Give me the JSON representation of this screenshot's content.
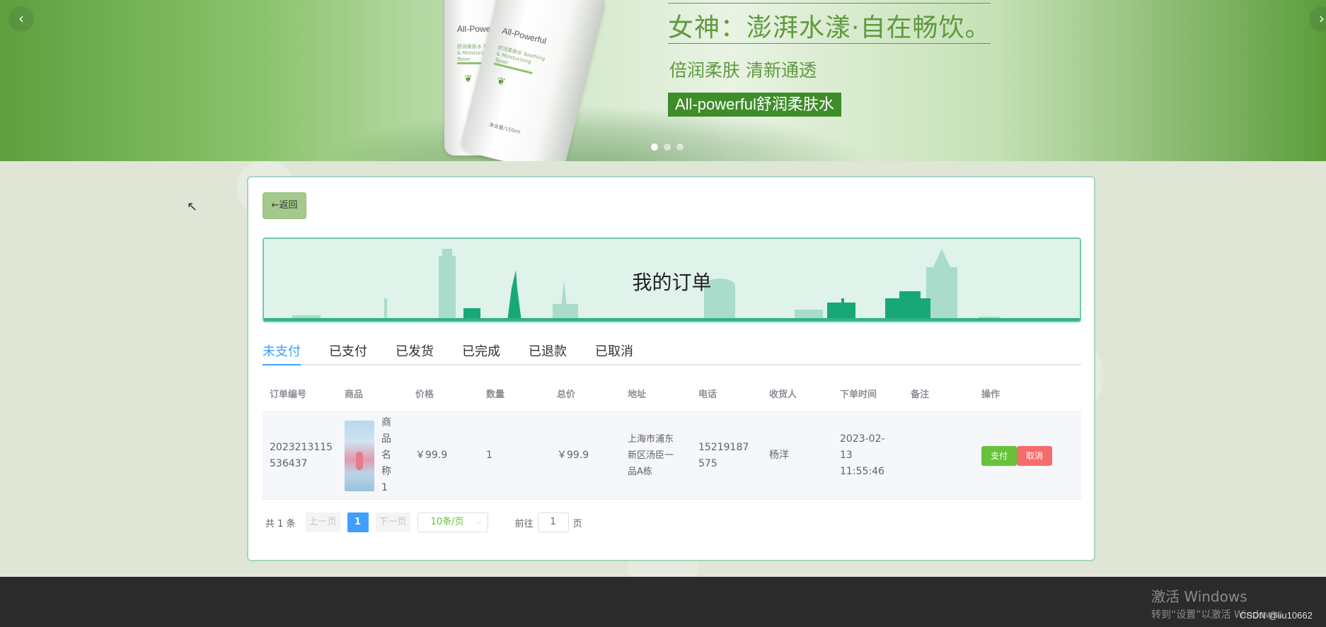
{
  "banner": {
    "headline": "女神：澎湃水漾·自在畅饮。",
    "subheadline": "倍润柔肤 清新通透",
    "tag": "All-powerful舒润柔肤水",
    "bottle_brand": "All-Powerful",
    "bottle_sub": "舒润柔肤水 Soothing & Moisturizing Toner",
    "bottle_volume": "净含量/150ml",
    "prev_arrow": "‹",
    "next_arrow": "›"
  },
  "back_button": "←返回",
  "page_title": "我的订单",
  "tabs": [
    {
      "label": "未支付"
    },
    {
      "label": "已支付"
    },
    {
      "label": "已发货"
    },
    {
      "label": "已完成"
    },
    {
      "label": "已退款"
    },
    {
      "label": "已取消"
    }
  ],
  "table": {
    "headers": [
      "订单编号",
      "商品",
      "价格",
      "数量",
      "总价",
      "地址",
      "电话",
      "收货人",
      "下单时间",
      "备注",
      "操作"
    ],
    "rows": [
      {
        "order_no": "2023213115536437",
        "product_name": "商品名称1",
        "price": "￥99.9",
        "quantity": "1",
        "total": "￥99.9",
        "address": "上海市浦东新区汤臣一品A栋",
        "phone": "15219187575",
        "receiver": "杨洋",
        "order_time": "2023-02-13 11:55:46",
        "remark": "",
        "pay_label": "支付",
        "cancel_label": "取消"
      }
    ]
  },
  "pagination": {
    "total": "共 1 条",
    "prev": "上一页",
    "current_page": "1",
    "next": "下一页",
    "page_size": "10条/页",
    "goto_prefix": "前往",
    "goto_value": "1",
    "goto_suffix": "页"
  },
  "watermark": {
    "line1": "激活 Windows",
    "line2": "转到“设置”以激活 Windows。"
  },
  "csdn": "CSDN @liu10662",
  "colors": {
    "accent": "#409eff",
    "pay": "#67c23a",
    "cancel": "#f56c6c",
    "banner_green": "#5f9a3d"
  }
}
